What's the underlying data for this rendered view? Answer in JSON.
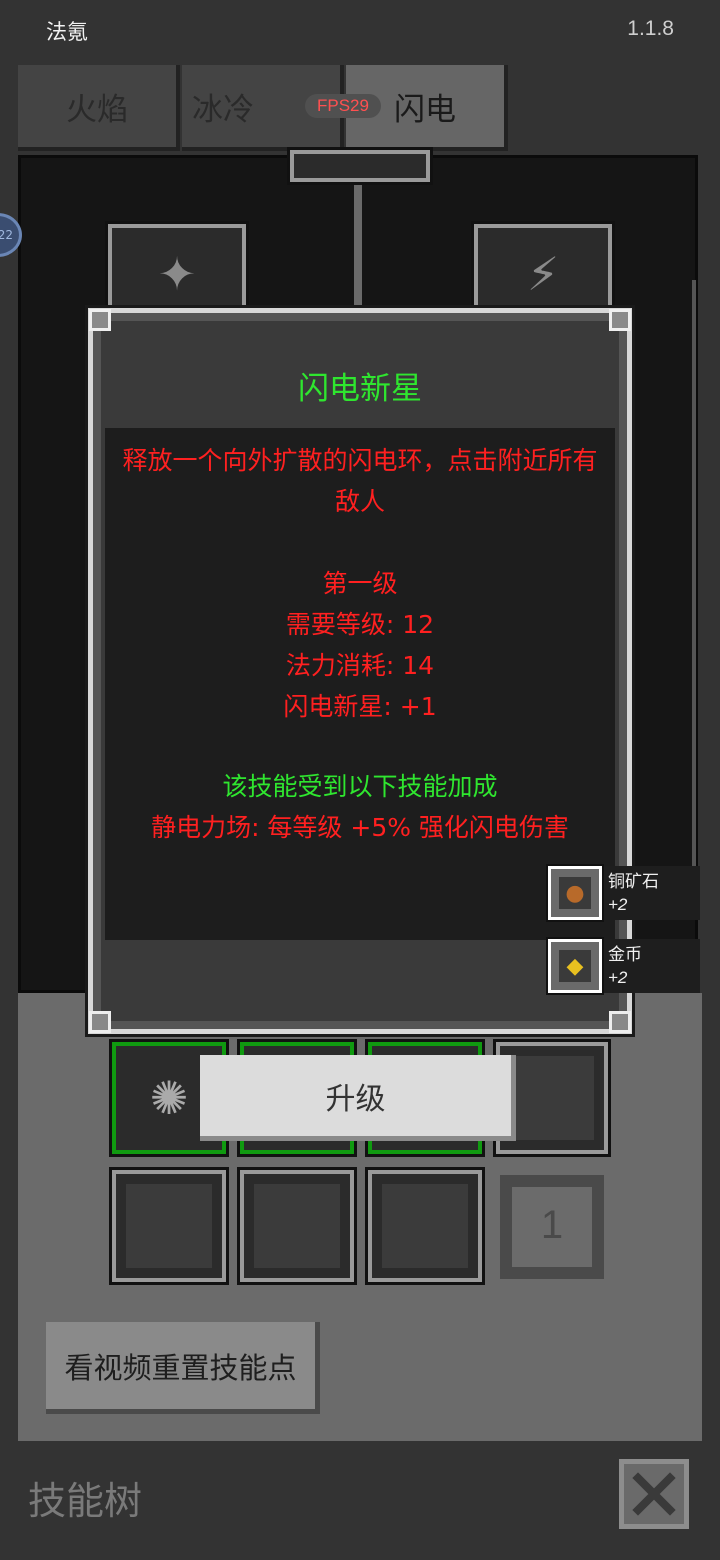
{
  "app": {
    "title": "法氪",
    "version": "1.1.8"
  },
  "tabs": [
    {
      "label": "火焰"
    },
    {
      "label": "冰冷"
    },
    {
      "label": "闪电"
    }
  ],
  "fps_badge": "FPS29",
  "floating_badge": "22",
  "dialog": {
    "title": "闪电新星",
    "description": "释放一个向外扩散的闪电环，点击附近所有敌人",
    "level_title": "第一级",
    "required_level": "需要等级: 12",
    "mana_cost": "法力消耗: 14",
    "skill_bonus": "闪电新星: +1",
    "synergy_header": "该技能受到以下技能加成",
    "synergy_line": "静电力场: 每等级 +5% 强化闪电伤害"
  },
  "pickups": [
    {
      "name": "铜矿石",
      "count": "+2",
      "icon": "copper-ore-icon"
    },
    {
      "name": "金币",
      "count": "+2",
      "icon": "gold-coin-icon"
    }
  ],
  "upgrade_button": "升级",
  "skill_points": "1",
  "reset_button": "看视频重置技能点",
  "footer": {
    "title": "技能树"
  },
  "colors": {
    "accent_green": "#2fe62f",
    "text_red": "#ff2020",
    "fps_red": "#ff5050"
  }
}
